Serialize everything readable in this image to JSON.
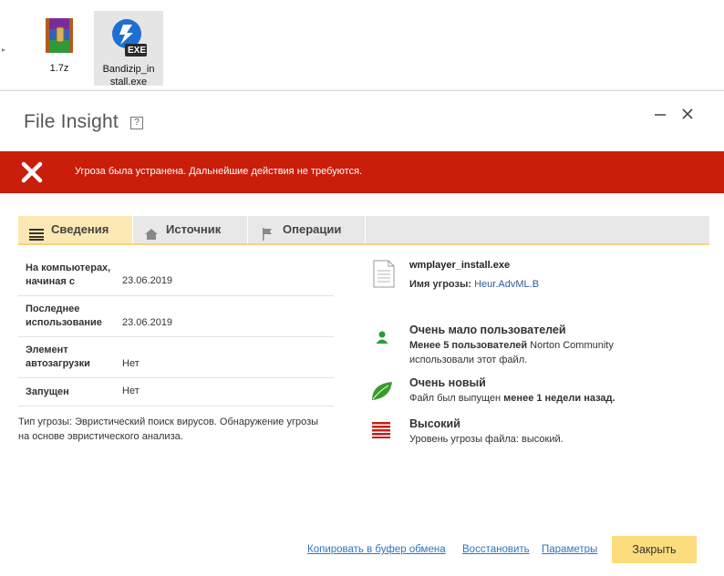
{
  "desktop": {
    "icons": [
      {
        "label": "1.7z",
        "icon": "winrar-archive-icon"
      },
      {
        "label_line1": "Bandizip_in",
        "label_line2": "stall.exe",
        "icon": "exe-installer-icon",
        "badge": "EXE"
      }
    ]
  },
  "dialog": {
    "title": "File Insight",
    "help": "?",
    "alert": {
      "text": "Угроза была устранена. Дальнейшие действия не требуются.",
      "color": "#c81e0a"
    },
    "tabs": [
      {
        "label": "Сведения",
        "icon": "details-list-icon",
        "active": true
      },
      {
        "label": "Источник",
        "icon": "home-icon",
        "active": false
      },
      {
        "label": "Операции",
        "icon": "flag-icon",
        "active": false
      }
    ],
    "details": [
      {
        "label_line1": "На компьютерах,",
        "label_line2": "начиная с",
        "value": "23.06.2019"
      },
      {
        "label_line1": "Последнее",
        "label_line2": "использование",
        "value": "23.06.2019"
      },
      {
        "label_line1": "Элемент",
        "label_line2": "автозагрузки",
        "value": "Нет"
      },
      {
        "label_line1": "Запущен",
        "label_line2": "",
        "value": "Нет"
      }
    ],
    "threat_desc_line1": "Тип угрозы: Эвристический поиск вирусов. Обнаружение угрозы",
    "threat_desc_line2": "на основе эвристического анализа.",
    "file": {
      "name": "wmplayer_install.exe",
      "threat_label": "Имя угрозы:",
      "threat_name": "Heur.AdvML.B"
    },
    "insights": [
      {
        "title": "Очень мало пользователей",
        "icon": "user-icon",
        "bold": "Менее 5 пользователей",
        "text": " Norton Community",
        "text2": "использовали этот файл."
      },
      {
        "title": "Очень новый",
        "icon": "leaf-icon",
        "text": "Файл был выпущен ",
        "bold": "менее 1 недели назад."
      },
      {
        "title": "Высокий",
        "icon": "threat-level-icon",
        "text": "Уровень угрозы файла: высокий."
      }
    ],
    "footer": {
      "copy": "Копировать в буфер обмена",
      "restore": "Восстановить",
      "settings": "Параметры",
      "close": "Закрыть"
    }
  }
}
